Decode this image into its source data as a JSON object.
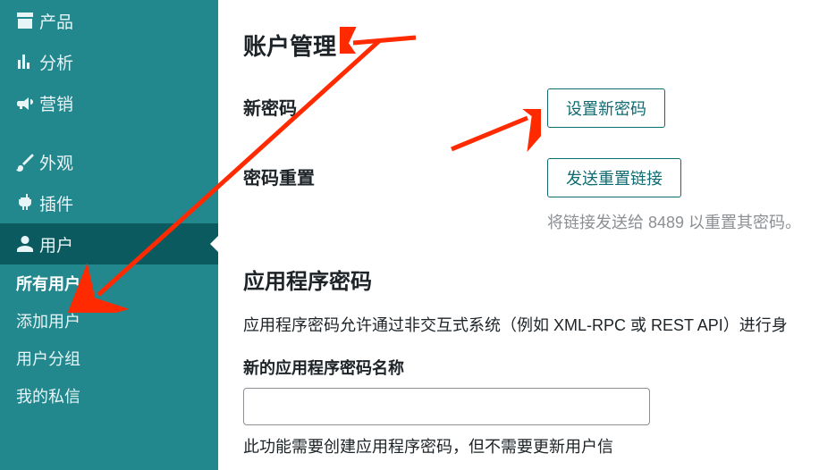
{
  "sidebar": {
    "items": [
      {
        "label": "产品",
        "icon": "archive-icon"
      },
      {
        "label": "分析",
        "icon": "chart-icon"
      },
      {
        "label": "营销",
        "icon": "megaphone-icon"
      },
      {
        "label": "外观",
        "icon": "brush-icon"
      },
      {
        "label": "插件",
        "icon": "plug-icon"
      },
      {
        "label": "用户",
        "icon": "user-icon"
      }
    ],
    "sub": {
      "all_users": "所有用户",
      "add_user": "添加用户",
      "user_groups": "用户分组",
      "my_messages": "我的私信"
    }
  },
  "content": {
    "title": "账户管理",
    "row1": {
      "label": "新密码",
      "button": "设置新密码"
    },
    "row2": {
      "label": "密码重置",
      "button": "发送重置链接",
      "helper": "将链接发送给 8489 以重置其密码。"
    },
    "app_pw": {
      "title": "应用程序密码",
      "desc": "应用程序密码允许通过非交互式系统（例如 XML-RPC 或 REST API）进行身",
      "new_label": "新的应用程序密码名称",
      "value": "",
      "helper": "此功能需要创建应用程序密码，但不需要更新用户信"
    }
  }
}
